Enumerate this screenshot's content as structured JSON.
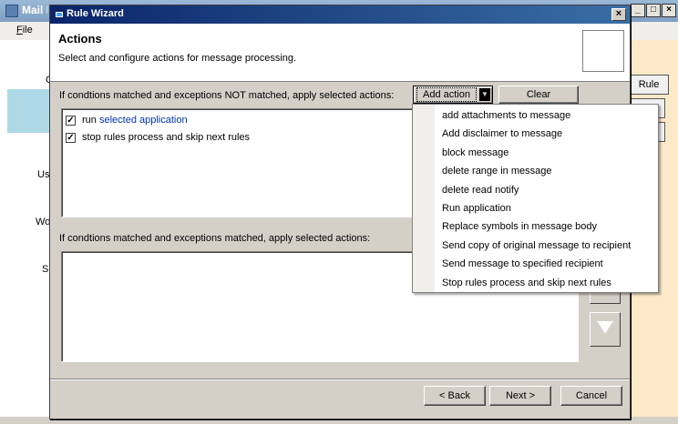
{
  "background_window": {
    "title_fragment": "Mail P",
    "menu_file": "File",
    "rule_button": "Rule",
    "fragments": [
      "C",
      "Us",
      "Wo",
      "S"
    ]
  },
  "dialog": {
    "title": "Rule Wizard",
    "close_glyph": "×",
    "heading": "Actions",
    "subtitle": "Select and configure  actions for message processing.",
    "label_not_matched": "If condtions matched and exceptions NOT matched, apply selected actions:",
    "label_matched": "If condtions matched and exceptions matched, apply selected actions:",
    "add_action_label": "Add action",
    "add_action_arrow": "▼",
    "clear_label": "Clear",
    "actions_not_matched": [
      {
        "checked": true,
        "prefix": "run ",
        "link": "selected application"
      },
      {
        "checked": true,
        "prefix": "stop rules process and skip next rules",
        "link": ""
      }
    ],
    "footer": {
      "back_label": "< Back",
      "next_label": "Next >",
      "cancel_label": "Cancel"
    }
  },
  "add_action_menu": {
    "items": [
      "add attachments to message",
      "Add disclaimer to message",
      "block message",
      "delete range in message",
      "delete read notify",
      "Run application",
      "Replace symbols in message body",
      "Send copy of original message to recipient",
      "Send message to specified recipient",
      "Stop rules process and skip next rules"
    ]
  },
  "colors": {
    "dialog_title_gradient_start": "#0a246a",
    "dialog_title_gradient_end": "#3a6ea5",
    "link_color": "#0033aa",
    "dialog_face": "#d4d0c8"
  }
}
